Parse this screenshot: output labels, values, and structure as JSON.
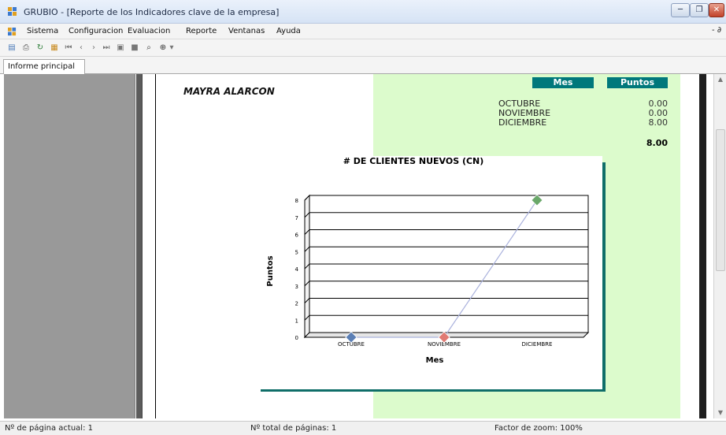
{
  "window": {
    "title": "GRUBIO - [Reporte  de los Indicadores  clave de la empresa]"
  },
  "menu": {
    "items": [
      "Sistema",
      "Configuracion",
      "Evaluacion",
      "Reporte",
      "Ventanas",
      "Ayuda"
    ],
    "mdi_controls": "- ∂"
  },
  "tabs": [
    {
      "label": "Informe principal"
    }
  ],
  "report": {
    "person": "MAYRA  ALARCON",
    "table": {
      "headers": {
        "month": "Mes",
        "points": "Puntos"
      },
      "rows": [
        {
          "month": "OCTUBRE",
          "points": "0.00"
        },
        {
          "month": "NOVIEMBRE",
          "points": "0.00"
        },
        {
          "month": "DICIEMBRE",
          "points": "8.00"
        }
      ],
      "total": "8.00"
    }
  },
  "chart_data": {
    "type": "line",
    "title": "# DE CLIENTES NUEVOS (CN)",
    "xlabel": "Mes",
    "ylabel": "Puntos",
    "categories": [
      "OCTUBRE",
      "NOVIEMBRE",
      "DICIEMBRE"
    ],
    "series": [
      {
        "values": [
          0,
          0,
          8
        ]
      }
    ],
    "marker_colors": [
      "#5b7fb5",
      "#e07a73",
      "#6aa86a"
    ],
    "line_color": "#aab2dd",
    "ylim": [
      0,
      8
    ],
    "yticks": [
      "0",
      "1",
      "2",
      "3",
      "4",
      "5",
      "6",
      "7",
      "8"
    ],
    "grid": true,
    "legend": "none"
  },
  "status": {
    "current_page": "Nº de página actual: 1",
    "total_pages": "Nº total de páginas: 1",
    "zoom": "Factor de zoom: 100%"
  },
  "colors": {
    "header_bg": "#00787b",
    "green_panel": "#dcfbcc"
  }
}
